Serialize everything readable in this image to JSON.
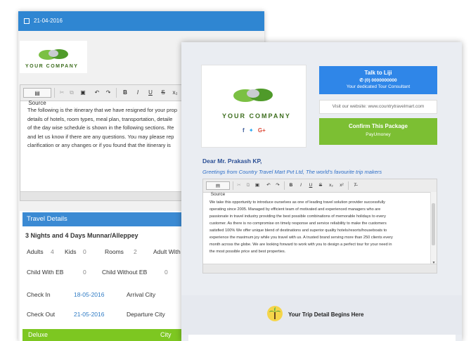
{
  "back": {
    "date": "21-04-2016",
    "logo_text": "YOUR COMPANY",
    "toolbar": {
      "source": "Source"
    },
    "editor_lines": [
      "The following is the itinerary that we have resigned for your prop",
      "details of hotels, room types, meal plan, transportation, detaile",
      "of the day wise schedule is shown in the following sections. Re",
      "and let us know if there are any questions. You may please rep",
      "clarification or any changes or if you found that the itinerary is"
    ],
    "travel_details": {
      "header": "Travel Details",
      "title": "3 Nights and 4 Days Munnar/Alleppey",
      "adults_label": "Adults",
      "adults": "4",
      "kids_label": "Kids",
      "kids": "0",
      "rooms_label": "Rooms",
      "rooms": "2",
      "adult_with_label": "Adult With",
      "child_with_eb_label": "Child With EB",
      "child_with_eb": "0",
      "child_without_eb_label": "Child Without EB",
      "child_without_eb": "0",
      "check_in_label": "Check In",
      "check_in": "18-05-2016",
      "arrival_city_label": "Arrival City",
      "check_out_label": "Check Out",
      "check_out": "21-05-2016",
      "departure_city_label": "Departure City"
    },
    "deluxe": {
      "label": "Deluxe",
      "city": "City"
    }
  },
  "front": {
    "logo_text": "YOUR COMPANY",
    "talk": {
      "title": "Talk to Liji",
      "phone": "(0) 0000000000",
      "subtitle": "Your dedicated Tour Consultant"
    },
    "website": "Visit our website: www.countrytravelmart.com",
    "confirm": {
      "title": "Confirm This Package",
      "pay": "PayUmoney"
    },
    "greeting_name": "Dear Mr. Prakash KP,",
    "greeting_line": "Greetings from Country Travel Mart Pvt Ltd, The world's favourite trip makers",
    "toolbar": {
      "source": "Source"
    },
    "editor_lines": [
      "We take this opportunity to introduce ourselves as one of leading travel solution provider successfully",
      "operating since 2005. Managed by efficient team of motivated and experienced managers who are",
      "passionate in travel industry providing the best possible combinations of memorable holidays to every",
      "customer. As there is no compromise on timely response and service reliability to make the customers",
      "satisfied 100% We offer unique blend of destinations and superior quality hotels/resorts/houseboats to",
      "experience the maximum joy while you travel with us. A trusted brand serving more than 250 clients every",
      "month across the globe. We are looking forward to work with you to design a perfect tour for your need in",
      "the most possible price and best properties."
    ],
    "trip_heading": "Your Trip Detail Begins Here"
  },
  "colors": {
    "primary_blue": "#2f86d2",
    "green": "#7cbf33",
    "link_blue": "#2f6fc8"
  }
}
